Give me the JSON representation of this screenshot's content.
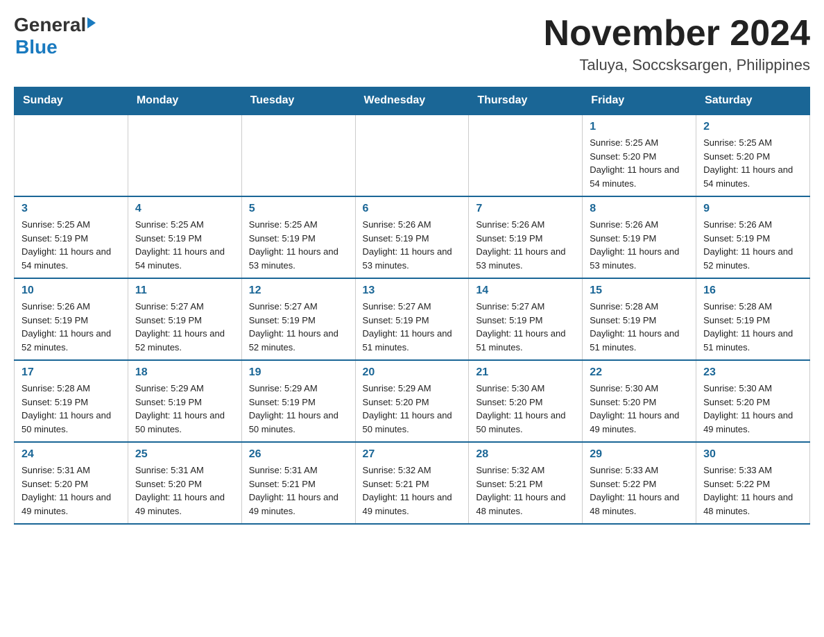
{
  "header": {
    "logo_general": "General",
    "logo_blue": "Blue",
    "month_title": "November 2024",
    "location": "Taluya, Soccsksargen, Philippines"
  },
  "days_of_week": [
    "Sunday",
    "Monday",
    "Tuesday",
    "Wednesday",
    "Thursday",
    "Friday",
    "Saturday"
  ],
  "weeks": [
    [
      {
        "day": "",
        "sunrise": "",
        "sunset": "",
        "daylight": ""
      },
      {
        "day": "",
        "sunrise": "",
        "sunset": "",
        "daylight": ""
      },
      {
        "day": "",
        "sunrise": "",
        "sunset": "",
        "daylight": ""
      },
      {
        "day": "",
        "sunrise": "",
        "sunset": "",
        "daylight": ""
      },
      {
        "day": "",
        "sunrise": "",
        "sunset": "",
        "daylight": ""
      },
      {
        "day": "1",
        "sunrise": "Sunrise: 5:25 AM",
        "sunset": "Sunset: 5:20 PM",
        "daylight": "Daylight: 11 hours and 54 minutes."
      },
      {
        "day": "2",
        "sunrise": "Sunrise: 5:25 AM",
        "sunset": "Sunset: 5:20 PM",
        "daylight": "Daylight: 11 hours and 54 minutes."
      }
    ],
    [
      {
        "day": "3",
        "sunrise": "Sunrise: 5:25 AM",
        "sunset": "Sunset: 5:19 PM",
        "daylight": "Daylight: 11 hours and 54 minutes."
      },
      {
        "day": "4",
        "sunrise": "Sunrise: 5:25 AM",
        "sunset": "Sunset: 5:19 PM",
        "daylight": "Daylight: 11 hours and 54 minutes."
      },
      {
        "day": "5",
        "sunrise": "Sunrise: 5:25 AM",
        "sunset": "Sunset: 5:19 PM",
        "daylight": "Daylight: 11 hours and 53 minutes."
      },
      {
        "day": "6",
        "sunrise": "Sunrise: 5:26 AM",
        "sunset": "Sunset: 5:19 PM",
        "daylight": "Daylight: 11 hours and 53 minutes."
      },
      {
        "day": "7",
        "sunrise": "Sunrise: 5:26 AM",
        "sunset": "Sunset: 5:19 PM",
        "daylight": "Daylight: 11 hours and 53 minutes."
      },
      {
        "day": "8",
        "sunrise": "Sunrise: 5:26 AM",
        "sunset": "Sunset: 5:19 PM",
        "daylight": "Daylight: 11 hours and 53 minutes."
      },
      {
        "day": "9",
        "sunrise": "Sunrise: 5:26 AM",
        "sunset": "Sunset: 5:19 PM",
        "daylight": "Daylight: 11 hours and 52 minutes."
      }
    ],
    [
      {
        "day": "10",
        "sunrise": "Sunrise: 5:26 AM",
        "sunset": "Sunset: 5:19 PM",
        "daylight": "Daylight: 11 hours and 52 minutes."
      },
      {
        "day": "11",
        "sunrise": "Sunrise: 5:27 AM",
        "sunset": "Sunset: 5:19 PM",
        "daylight": "Daylight: 11 hours and 52 minutes."
      },
      {
        "day": "12",
        "sunrise": "Sunrise: 5:27 AM",
        "sunset": "Sunset: 5:19 PM",
        "daylight": "Daylight: 11 hours and 52 minutes."
      },
      {
        "day": "13",
        "sunrise": "Sunrise: 5:27 AM",
        "sunset": "Sunset: 5:19 PM",
        "daylight": "Daylight: 11 hours and 51 minutes."
      },
      {
        "day": "14",
        "sunrise": "Sunrise: 5:27 AM",
        "sunset": "Sunset: 5:19 PM",
        "daylight": "Daylight: 11 hours and 51 minutes."
      },
      {
        "day": "15",
        "sunrise": "Sunrise: 5:28 AM",
        "sunset": "Sunset: 5:19 PM",
        "daylight": "Daylight: 11 hours and 51 minutes."
      },
      {
        "day": "16",
        "sunrise": "Sunrise: 5:28 AM",
        "sunset": "Sunset: 5:19 PM",
        "daylight": "Daylight: 11 hours and 51 minutes."
      }
    ],
    [
      {
        "day": "17",
        "sunrise": "Sunrise: 5:28 AM",
        "sunset": "Sunset: 5:19 PM",
        "daylight": "Daylight: 11 hours and 50 minutes."
      },
      {
        "day": "18",
        "sunrise": "Sunrise: 5:29 AM",
        "sunset": "Sunset: 5:19 PM",
        "daylight": "Daylight: 11 hours and 50 minutes."
      },
      {
        "day": "19",
        "sunrise": "Sunrise: 5:29 AM",
        "sunset": "Sunset: 5:19 PM",
        "daylight": "Daylight: 11 hours and 50 minutes."
      },
      {
        "day": "20",
        "sunrise": "Sunrise: 5:29 AM",
        "sunset": "Sunset: 5:20 PM",
        "daylight": "Daylight: 11 hours and 50 minutes."
      },
      {
        "day": "21",
        "sunrise": "Sunrise: 5:30 AM",
        "sunset": "Sunset: 5:20 PM",
        "daylight": "Daylight: 11 hours and 50 minutes."
      },
      {
        "day": "22",
        "sunrise": "Sunrise: 5:30 AM",
        "sunset": "Sunset: 5:20 PM",
        "daylight": "Daylight: 11 hours and 49 minutes."
      },
      {
        "day": "23",
        "sunrise": "Sunrise: 5:30 AM",
        "sunset": "Sunset: 5:20 PM",
        "daylight": "Daylight: 11 hours and 49 minutes."
      }
    ],
    [
      {
        "day": "24",
        "sunrise": "Sunrise: 5:31 AM",
        "sunset": "Sunset: 5:20 PM",
        "daylight": "Daylight: 11 hours and 49 minutes."
      },
      {
        "day": "25",
        "sunrise": "Sunrise: 5:31 AM",
        "sunset": "Sunset: 5:20 PM",
        "daylight": "Daylight: 11 hours and 49 minutes."
      },
      {
        "day": "26",
        "sunrise": "Sunrise: 5:31 AM",
        "sunset": "Sunset: 5:21 PM",
        "daylight": "Daylight: 11 hours and 49 minutes."
      },
      {
        "day": "27",
        "sunrise": "Sunrise: 5:32 AM",
        "sunset": "Sunset: 5:21 PM",
        "daylight": "Daylight: 11 hours and 49 minutes."
      },
      {
        "day": "28",
        "sunrise": "Sunrise: 5:32 AM",
        "sunset": "Sunset: 5:21 PM",
        "daylight": "Daylight: 11 hours and 48 minutes."
      },
      {
        "day": "29",
        "sunrise": "Sunrise: 5:33 AM",
        "sunset": "Sunset: 5:22 PM",
        "daylight": "Daylight: 11 hours and 48 minutes."
      },
      {
        "day": "30",
        "sunrise": "Sunrise: 5:33 AM",
        "sunset": "Sunset: 5:22 PM",
        "daylight": "Daylight: 11 hours and 48 minutes."
      }
    ]
  ]
}
